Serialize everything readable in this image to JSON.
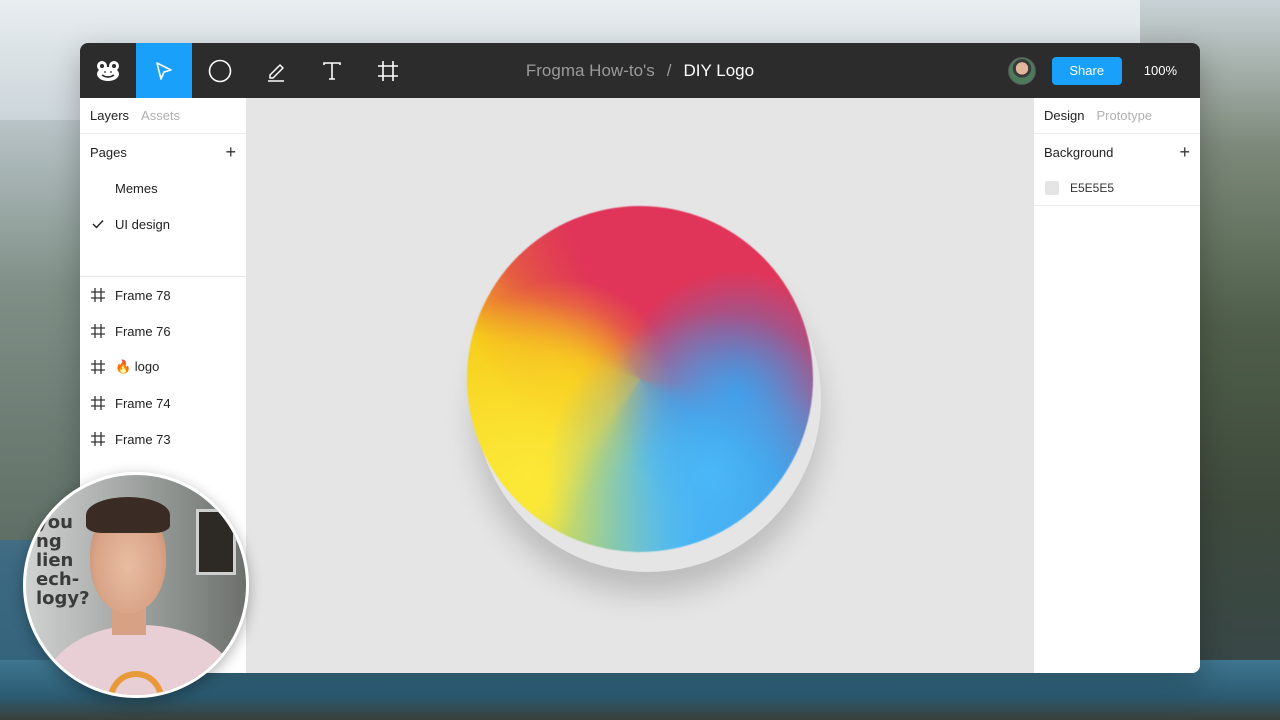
{
  "toolbar": {
    "tools": [
      {
        "icon": "frog-logo-icon"
      },
      {
        "icon": "cursor-icon",
        "active": true
      },
      {
        "icon": "ellipse-icon"
      },
      {
        "icon": "pen-icon"
      },
      {
        "icon": "text-icon"
      },
      {
        "icon": "frame-icon"
      }
    ],
    "project": "Frogma How-to's",
    "separator": "/",
    "file": "DIY Logo",
    "share_label": "Share",
    "zoom": "100%",
    "accent_color": "#18A0FB"
  },
  "left_panel": {
    "tabs": [
      "Layers",
      "Assets"
    ],
    "pages_title": "Pages",
    "pages": [
      {
        "label": "Memes",
        "checked": false
      },
      {
        "label": "UI design",
        "checked": true
      }
    ],
    "layers": [
      {
        "label": "Frame 78",
        "icon": "frame-icon"
      },
      {
        "label": "Frame 76",
        "icon": "frame-icon"
      },
      {
        "label": "🔥 logo",
        "icon": "frame-icon"
      },
      {
        "label": "Frame 74",
        "icon": "frame-icon"
      },
      {
        "label": "Frame 73",
        "icon": "frame-icon"
      }
    ]
  },
  "right_panel": {
    "tabs": [
      "Design",
      "Prototype"
    ],
    "background_title": "Background",
    "background_value": "E5E5E5"
  },
  "canvas": {
    "background_color": "#E5E5E5",
    "logo_colors": [
      "#E0365A",
      "#3A8AD8",
      "#4AB8F8",
      "#F9E33A",
      "#F6C814"
    ]
  },
  "webcam": {
    "wall_text": "you\nng\nlien\nech-\nlogy?"
  }
}
